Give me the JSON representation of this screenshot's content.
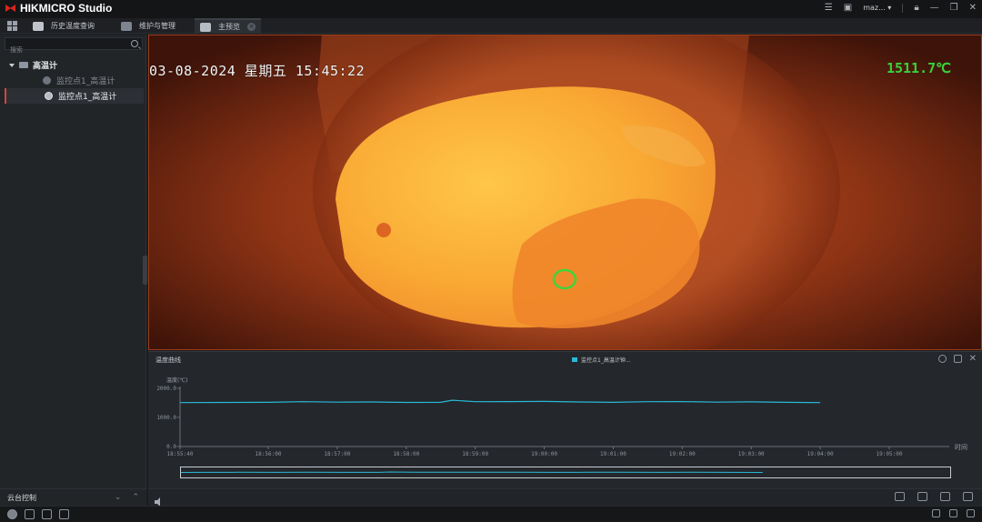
{
  "app": {
    "title": "HIKMICRO Studio"
  },
  "window": {
    "user": "maz..."
  },
  "tabs": [
    {
      "label": "历史温度查询"
    },
    {
      "label": "维护与管理"
    },
    {
      "label": "主预览"
    }
  ],
  "sidebar": {
    "search_placeholder": "搜索",
    "root_label": "高温计",
    "items": [
      {
        "label": "监控点1_高温计"
      },
      {
        "label": "监控点1_高温计"
      }
    ],
    "ptz_label": "云台控制"
  },
  "video": {
    "osd_datetime": "03-08-2024  星期五  15:45:22",
    "osd_temperature": "1511.7℃"
  },
  "curve": {
    "title": "温度曲线",
    "legend": "监控点1_高温计钟...",
    "x_unit": "时间"
  },
  "chart_data": {
    "type": "line",
    "title": "",
    "ylabel": "温度(℃)",
    "xlabel": "时间",
    "ylim": [
      0,
      2000
    ],
    "y_ticks": [
      "2000.0",
      "1000.0",
      "0.0"
    ],
    "x_ticks": [
      "18:55:40",
      "18:56:00",
      "18:57:00",
      "18:58:00",
      "18:59:00",
      "19:00:00",
      "19:01:00",
      "19:02:00",
      "19:03:00",
      "19:04:00",
      "19:05:00"
    ],
    "series": [
      {
        "name": "监控点1_高温计钟...",
        "color": "#29b9d6",
        "x": [
          "18:55:40",
          "18:56:00",
          "18:56:30",
          "18:57:00",
          "18:57:30",
          "18:58:00",
          "18:58:30",
          "18:58:40",
          "18:59:00",
          "18:59:30",
          "19:00:00",
          "19:00:30",
          "19:01:00",
          "19:01:30",
          "19:02:00",
          "19:02:30",
          "19:03:00",
          "19:03:30",
          "19:04:00"
        ],
        "values": [
          1510,
          1520,
          1540,
          1525,
          1530,
          1515,
          1520,
          1590,
          1540,
          1545,
          1550,
          1530,
          1520,
          1540,
          1545,
          1525,
          1535,
          1520,
          1510
        ]
      }
    ]
  }
}
